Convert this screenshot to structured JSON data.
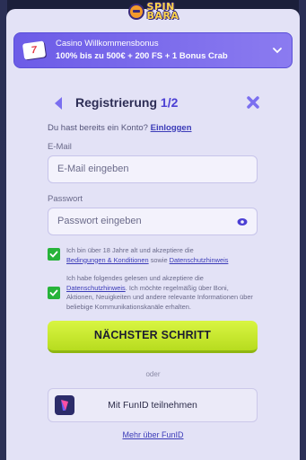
{
  "logo": {
    "line1": "SPIN",
    "line2": "BARA"
  },
  "bonus": {
    "badge": "7",
    "title": "Casino Willkommensbonus",
    "desc": "100% bis zu 500€ + 200 FS + 1 Bonus Crab"
  },
  "form": {
    "title": "Registrierung",
    "step": "1/2",
    "login_prompt": "Du hast bereits ein Konto?",
    "login_link": "Einloggen",
    "email_label": "E-Mail",
    "email_placeholder": "E-Mail eingeben",
    "password_label": "Passwort",
    "password_placeholder": "Passwort eingeben",
    "terms": {
      "pre": "Ich bin über 18 Jahre alt und akzeptiere die",
      "link1": "Bedingungen & Konditionen",
      "mid": "sowie",
      "link2": "Datenschutzhinweis",
      "checked": true
    },
    "marketing": {
      "pre": "Ich habe folgendes gelesen und akzeptiere die",
      "link": "Datenschutzhinweis",
      "post": ". Ich möchte regelmäßig über Boni, Aktionen, Neuigkeiten und andere relevante Informationen über beliebige Kommunikationskanäle erhalten.",
      "checked": true
    },
    "next_button": "NÄCHSTER SCHRITT",
    "or": "oder",
    "funid_button": "Mit FunID teilnehmen",
    "more_link": "Mehr über FunID"
  },
  "colors": {
    "accent": "#4b3fd4",
    "cta": "#c8e92f",
    "check": "#27b33a",
    "panel": "#e3e2f6"
  }
}
